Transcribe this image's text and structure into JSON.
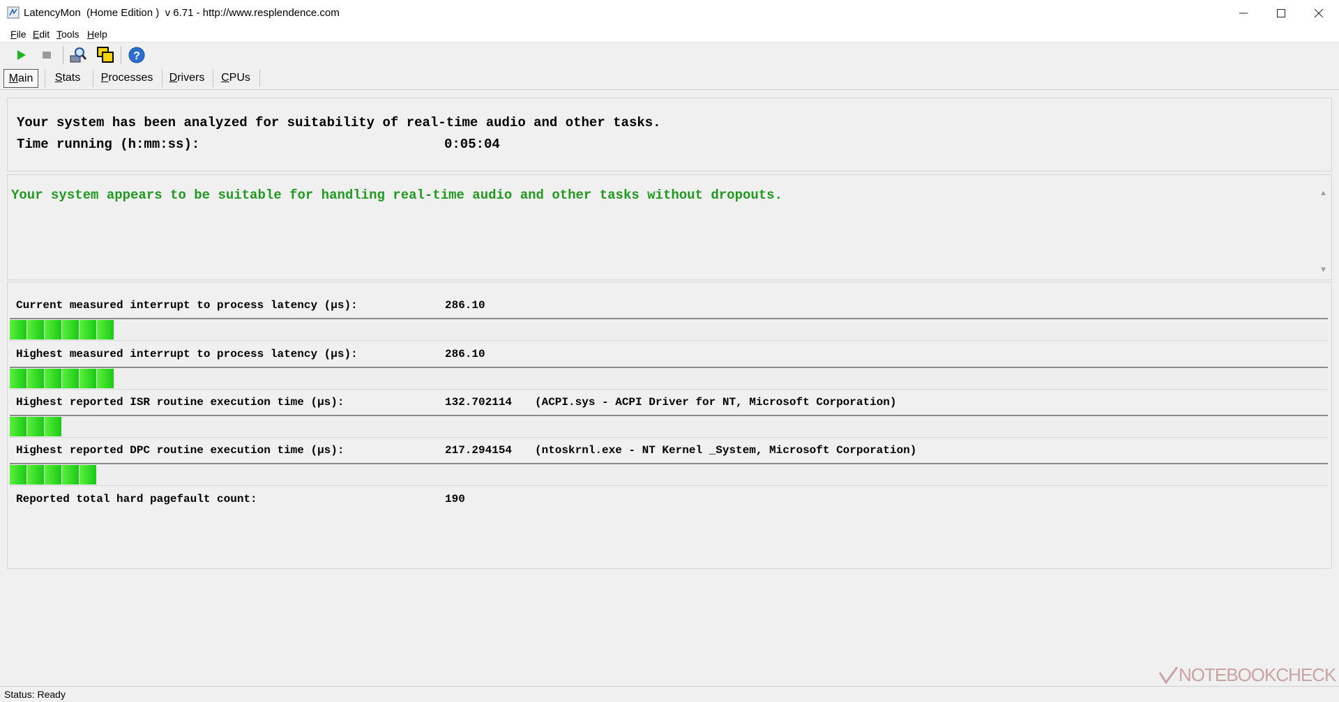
{
  "window": {
    "title": "LatencyMon  (Home Edition )  v 6.71 - http://www.resplendence.com"
  },
  "menu": [
    {
      "key": "F",
      "rest": "ile"
    },
    {
      "key": "E",
      "rest": "dit"
    },
    {
      "key": "T",
      "rest": "ools"
    },
    {
      "key": "H",
      "rest": "elp"
    }
  ],
  "toolbar": {
    "icons": [
      "play-icon",
      "stop-icon",
      "analyze-icon",
      "windows-icon",
      "help-icon"
    ]
  },
  "tabs": [
    {
      "key": "M",
      "rest": "ain",
      "active": true
    },
    {
      "key": "S",
      "rest": "tats",
      "active": false
    },
    {
      "key": "P",
      "rest": "rocesses",
      "active": false
    },
    {
      "key": "D",
      "rest": "rivers",
      "active": false
    },
    {
      "key": "C",
      "rest": "PUs",
      "active": false
    }
  ],
  "summary": {
    "line1": "Your system has been analyzed for suitability of real-time audio and other tasks.",
    "time_label": "Time running (h:mm:ss):",
    "time_value": "0:05:04"
  },
  "verdict": {
    "message": "Your system appears to be suitable for handling real-time audio and other tasks without dropouts.",
    "color": "#1f9a1f"
  },
  "stats": [
    {
      "label": "Current measured interrupt to process latency (µs):",
      "value": "286.10",
      "extra": "",
      "bar_segments": 6
    },
    {
      "label": "Highest measured interrupt to process latency (µs):",
      "value": "286.10",
      "extra": "",
      "bar_segments": 6
    },
    {
      "label": "Highest reported ISR routine execution time (µs):",
      "value": "132.702114",
      "extra": "(ACPI.sys - ACPI Driver for NT, Microsoft Corporation)",
      "bar_segments": 3
    },
    {
      "label": "Highest reported DPC routine execution time (µs):",
      "value": "217.294154",
      "extra": "(ntoskrnl.exe - NT Kernel _System, Microsoft Corporation)",
      "bar_segments": 5
    },
    {
      "label": "Reported total hard pagefault count:",
      "value": "190",
      "extra": "",
      "bar_segments": 0
    }
  ],
  "status": {
    "text": "Status: Ready"
  },
  "watermark": {
    "text": "NOTEBOOKCHECK"
  }
}
